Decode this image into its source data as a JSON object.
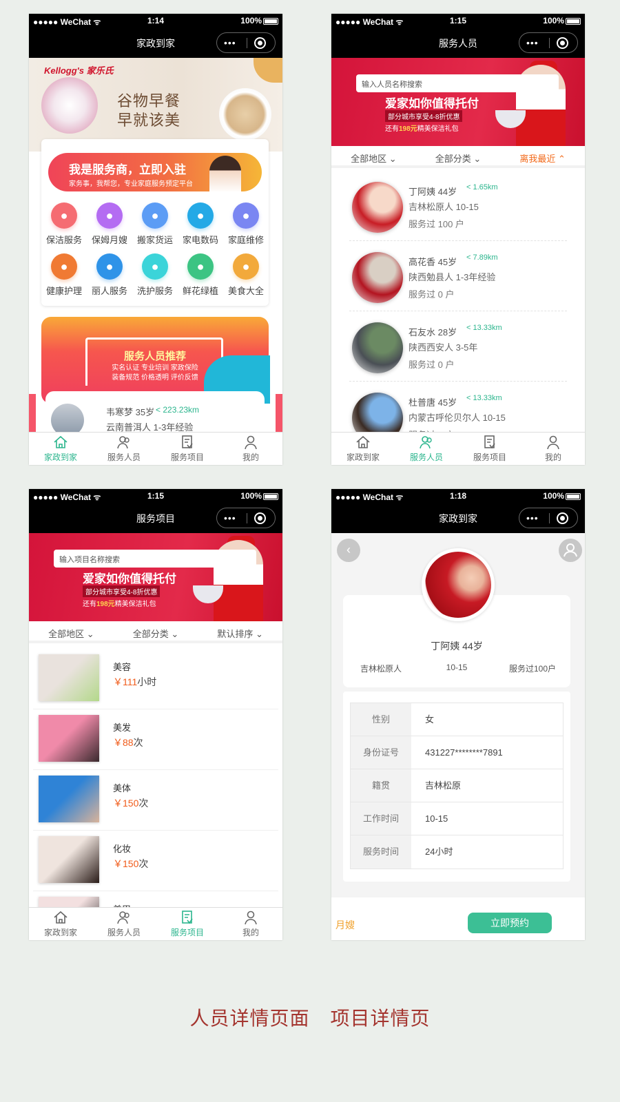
{
  "status_bars": [
    {
      "carrier": "●●●●● WeChat ᯤ",
      "time": "1:14",
      "battery": "100%"
    },
    {
      "carrier": "●●●●● WeChat ᯤ",
      "time": "1:15",
      "battery": "100%"
    },
    {
      "carrier": "●●●●● WeChat ᯤ",
      "time": "1:15",
      "battery": "100%"
    },
    {
      "carrier": "●●●●● WeChat ᯤ",
      "time": "1:18",
      "battery": "100%"
    }
  ],
  "titles": [
    "家政到家",
    "服务人员",
    "服务项目",
    "家政到家"
  ],
  "capsule_dots": "•••",
  "tabs": [
    "家政到家",
    "服务人员",
    "服务项目",
    "我的"
  ],
  "home": {
    "banner": {
      "brand": "Kellogg's 家乐氏",
      "line1": "谷物早餐",
      "line2": "早就该美"
    },
    "join": {
      "title": "我是服务商，立即入驻",
      "sub": "家务事，我帮您，专业家庭服务预定平台"
    },
    "services": [
      {
        "label": "保洁服务",
        "color": "#f56c72",
        "icon": "spray-icon"
      },
      {
        "label": "保姆月嫂",
        "color": "#b46cf2",
        "icon": "nanny-icon"
      },
      {
        "label": "搬家货运",
        "color": "#5b9cf5",
        "icon": "truck-icon"
      },
      {
        "label": "家电数码",
        "color": "#24a9e6",
        "icon": "monitor-icon"
      },
      {
        "label": "家庭维修",
        "color": "#7a86f2",
        "icon": "toolbox-icon"
      },
      {
        "label": "健康护理",
        "color": "#f07a33",
        "icon": "care-icon"
      },
      {
        "label": "丽人服务",
        "color": "#2f93e8",
        "icon": "beauty-icon"
      },
      {
        "label": "洗护服务",
        "color": "#3bd4d9",
        "icon": "laundry-icon"
      },
      {
        "label": "鲜花绿植",
        "color": "#3cc483",
        "icon": "flower-icon"
      },
      {
        "label": "美食大全",
        "color": "#f2a93b",
        "icon": "food-icon"
      }
    ],
    "recommend": {
      "title": "服务人员推荐",
      "sub1": "实名认证  专业培训  家政保险",
      "sub2": "装备规范  价格透明  评价反馈"
    },
    "person": {
      "name": "韦寒梦 35岁",
      "dist": "< 223.23km",
      "addr": "云南普洱人 1-3年经验"
    }
  },
  "staff": {
    "search_placeholder": "输入人员名称搜索",
    "ad": {
      "l1": "爱家如你值得托付",
      "l2": "部分城市享受4-8折优惠",
      "l3a": "还有",
      "l3b": "198元",
      "l3c": "精美保洁礼包"
    },
    "filters": [
      "全部地区 ⌄",
      "全部分类 ⌄",
      "离我最近 ⌃"
    ],
    "people": [
      {
        "name": "丁阿姨 44岁",
        "dist": "< 1.65km",
        "addr": "吉林松原人 10-15",
        "served": "服务过 100 户",
        "c1": "#f7d9c9",
        "c2": "#c81d25"
      },
      {
        "name": "高花香 45岁",
        "dist": "< 7.89km",
        "addr": "陕西勉县人 1-3年经验",
        "served": "服务过 0 户",
        "c1": "#d9cfc4",
        "c2": "#b31420"
      },
      {
        "name": "石友水  28岁",
        "dist": "< 13.33km",
        "addr": "陕西西安人 3-5年",
        "served": "服务过 0 户",
        "c1": "#6b8a63",
        "c2": "#4a4f55"
      },
      {
        "name": "杜普唐 45岁",
        "dist": "< 13.33km",
        "addr": "内蒙古呼伦贝尔人 10-15",
        "served": "服务过 0 户",
        "c1": "#7db3e8",
        "c2": "#3a2a22"
      }
    ]
  },
  "items": {
    "search_placeholder": "输入项目名称搜索",
    "filters": [
      "全部地区 ⌄",
      "全部分类 ⌄",
      "默认排序 ⌄"
    ],
    "list": [
      {
        "name": "美容",
        "price": "￥111",
        "unit": "小时",
        "c1": "#e9e2dd",
        "c2": "#b3d88a"
      },
      {
        "name": "美发",
        "price": "￥88",
        "unit": "次",
        "c1": "#f08aa9",
        "c2": "#3a2a2e"
      },
      {
        "name": "美体",
        "price": "￥150",
        "unit": "次",
        "c1": "#2f83d6",
        "c2": "#d9b39a"
      },
      {
        "name": "化妆",
        "price": "￥150",
        "unit": "次",
        "c1": "#efe4de",
        "c2": "#2a1c18"
      },
      {
        "name": "美甲",
        "price": "",
        "unit": "",
        "c1": "#f3e0e0",
        "c2": "#222"
      }
    ]
  },
  "detail": {
    "back": "‹",
    "name": "丁阿姨   44岁",
    "meta": [
      "吉林松原人",
      "10-15",
      "服务过100户"
    ],
    "rows": [
      {
        "k": "性别",
        "v": "女"
      },
      {
        "k": "身份证号",
        "v": "431227********7891"
      },
      {
        "k": "籍贯",
        "v": "吉林松原"
      },
      {
        "k": "工作时间",
        "v": "10-15"
      },
      {
        "k": "服务时间",
        "v": "24小时"
      }
    ],
    "left_label": "月嫂",
    "book": "立即预约"
  },
  "caption": [
    "人员详情页面",
    "项目详情页"
  ]
}
